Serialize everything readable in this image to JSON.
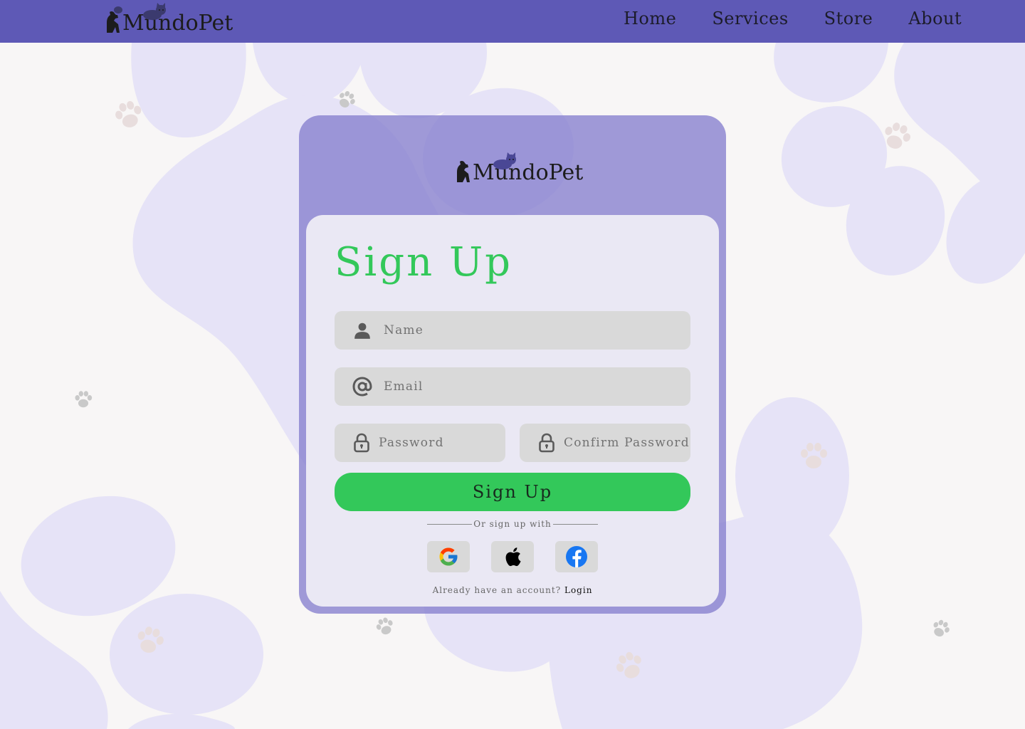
{
  "brand": {
    "name": "MundoPet"
  },
  "nav": {
    "links": [
      "Home",
      "Services",
      "Store",
      "About"
    ]
  },
  "form": {
    "title": "Sign Up",
    "fields": {
      "name": {
        "placeholder": "Name",
        "icon": "person-icon"
      },
      "email": {
        "placeholder": "Email",
        "icon": "at-sign-icon"
      },
      "password": {
        "placeholder": "Password",
        "icon": "lock-icon"
      },
      "confirm_password": {
        "placeholder": "Confirm Password",
        "icon": "lock-icon"
      }
    },
    "submit_label": "Sign Up",
    "divider_text": "Or sign up with",
    "social": [
      {
        "name": "google",
        "icon": "google-icon"
      },
      {
        "name": "apple",
        "icon": "apple-icon"
      },
      {
        "name": "facebook",
        "icon": "facebook-icon"
      }
    ],
    "login_prompt": "Already have an account?",
    "login_link": "Login"
  },
  "colors": {
    "navbar": "#5e59b6",
    "accent_green": "#33c85a",
    "card": "#857fce",
    "background_blob": "#e6e3f7",
    "background": "#f8f6f6",
    "input": "#d9d9d9"
  }
}
